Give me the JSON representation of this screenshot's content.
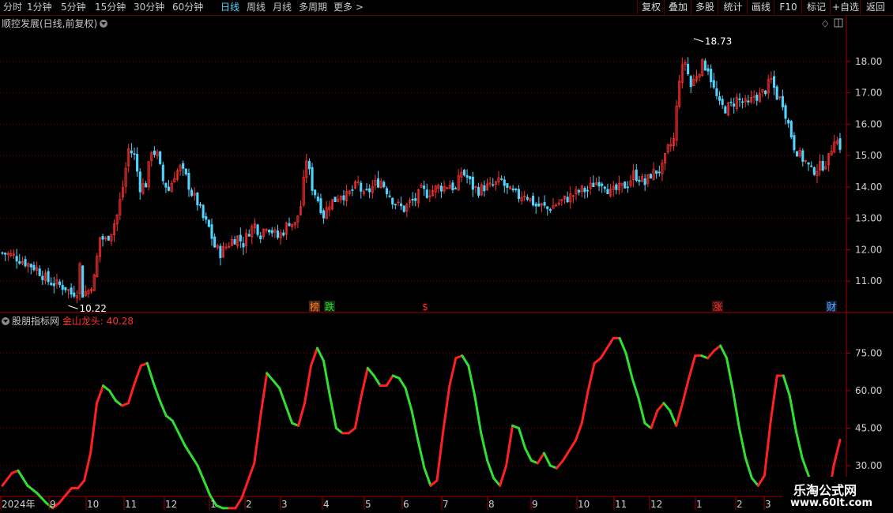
{
  "toolbar": {
    "periods": [
      "分时",
      "1分钟",
      "5分钟",
      "15分钟",
      "30分钟",
      "60分钟",
      "日线",
      "周线",
      "月线",
      "多周期",
      "更多 >"
    ],
    "active_period": "日线",
    "right_buttons": [
      "复权",
      "叠加",
      "多股",
      "统计",
      "画线",
      "F10",
      "标记",
      "+自选",
      "返回"
    ]
  },
  "main_chart": {
    "title": "顺控发展(日线,前复权)",
    "price_ticks": [
      "18.00",
      "17.00",
      "16.00",
      "15.00",
      "14.00",
      "13.00",
      "12.00",
      "11.00"
    ],
    "high_label": "18.73",
    "low_label": "10.22",
    "markers": [
      {
        "text": "榜",
        "color": "#ff7a2a",
        "bg": "#4a2a10"
      },
      {
        "text": "跌",
        "color": "#30e030",
        "bg": "#103010"
      },
      {
        "text": "$",
        "color": "#ff3030",
        "bg": "#000000"
      },
      {
        "text": "涨",
        "color": "#ff3030",
        "bg": "#3a1010"
      },
      {
        "text": "财",
        "color": "#5fb0ff",
        "bg": "#102040"
      }
    ]
  },
  "indicator": {
    "name": "股朋指标网",
    "series_label": "金山龙头: 40.28",
    "ticks": [
      "75.00",
      "60.00",
      "45.00",
      "30.00"
    ]
  },
  "x_axis": {
    "labels": [
      "2024年",
      "9",
      "10",
      "11",
      "12",
      "1",
      "2",
      "3",
      "4",
      "5",
      "6",
      "7",
      "8",
      "9",
      "10",
      "11",
      "12",
      "1",
      "2",
      "3"
    ]
  },
  "watermark": {
    "line1": "乐淘公式网",
    "line2": "www.60lt.com"
  },
  "colors": {
    "up": "#ff3030",
    "down": "#4fd6ff",
    "line_up": "#ff2020",
    "line_down": "#30e030",
    "grid": "#7a0000",
    "frame": "#a00000"
  },
  "chart_data": [
    {
      "type": "candlestick",
      "title": "顺控发展(日线,前复权)",
      "ylim": [
        10.0,
        19.0
      ],
      "high": 18.73,
      "low": 10.22,
      "close_path": [
        [
          0,
          11.9
        ],
        [
          4,
          11.8
        ],
        [
          8,
          11.6
        ],
        [
          12,
          11.4
        ],
        [
          16,
          11.0
        ],
        [
          19,
          10.9
        ],
        [
          22,
          10.8
        ],
        [
          24,
          10.6
        ],
        [
          26,
          10.7
        ],
        [
          27,
          11.5
        ],
        [
          28,
          10.6
        ],
        [
          30,
          10.7
        ],
        [
          32,
          11.1
        ],
        [
          34,
          12.4
        ],
        [
          36,
          12.3
        ],
        [
          38,
          12.6
        ],
        [
          40,
          13.1
        ],
        [
          42,
          14.0
        ],
        [
          44,
          15.2
        ],
        [
          46,
          15.0
        ],
        [
          48,
          14.0
        ],
        [
          50,
          14.1
        ],
        [
          52,
          15.2
        ],
        [
          54,
          15.0
        ],
        [
          56,
          14.2
        ],
        [
          58,
          13.9
        ],
        [
          60,
          14.4
        ],
        [
          62,
          14.6
        ],
        [
          64,
          14.3
        ],
        [
          66,
          13.8
        ],
        [
          68,
          13.5
        ],
        [
          70,
          13.0
        ],
        [
          72,
          12.7
        ],
        [
          74,
          12.1
        ],
        [
          76,
          11.9
        ],
        [
          78,
          12.1
        ],
        [
          80,
          12.3
        ],
        [
          82,
          12.4
        ],
        [
          84,
          12.2
        ],
        [
          86,
          12.6
        ],
        [
          88,
          12.8
        ],
        [
          90,
          12.5
        ],
        [
          92,
          12.8
        ],
        [
          94,
          12.6
        ],
        [
          96,
          12.4
        ],
        [
          98,
          12.6
        ],
        [
          100,
          12.9
        ],
        [
          102,
          12.8
        ],
        [
          104,
          13.4
        ],
        [
          106,
          14.9
        ],
        [
          108,
          14.0
        ],
        [
          110,
          13.6
        ],
        [
          112,
          13.1
        ],
        [
          114,
          13.5
        ],
        [
          116,
          13.6
        ],
        [
          118,
          13.8
        ],
        [
          120,
          13.7
        ],
        [
          122,
          13.9
        ],
        [
          124,
          14.1
        ],
        [
          126,
          13.7
        ],
        [
          128,
          13.9
        ],
        [
          130,
          14.1
        ],
        [
          132,
          14.2
        ],
        [
          134,
          13.9
        ],
        [
          136,
          13.6
        ],
        [
          138,
          13.4
        ],
        [
          140,
          13.3
        ],
        [
          142,
          13.5
        ],
        [
          144,
          13.6
        ],
        [
          146,
          13.9
        ],
        [
          148,
          13.8
        ],
        [
          150,
          13.9
        ],
        [
          152,
          14.0
        ],
        [
          154,
          14.0
        ],
        [
          156,
          14.1
        ],
        [
          158,
          13.9
        ],
        [
          160,
          14.5
        ],
        [
          162,
          14.3
        ],
        [
          164,
          14.0
        ],
        [
          166,
          13.9
        ],
        [
          168,
          14.0
        ],
        [
          170,
          14.0
        ],
        [
          172,
          14.1
        ],
        [
          174,
          14.2
        ],
        [
          176,
          13.9
        ],
        [
          178,
          13.8
        ],
        [
          180,
          13.7
        ],
        [
          182,
          13.8
        ],
        [
          184,
          13.6
        ],
        [
          186,
          13.4
        ],
        [
          188,
          13.4
        ],
        [
          190,
          13.3
        ],
        [
          192,
          13.4
        ],
        [
          194,
          13.5
        ],
        [
          196,
          13.6
        ],
        [
          198,
          13.7
        ],
        [
          200,
          13.8
        ],
        [
          202,
          13.9
        ],
        [
          204,
          13.9
        ],
        [
          206,
          14.1
        ],
        [
          208,
          14.2
        ],
        [
          210,
          14.1
        ],
        [
          212,
          13.8
        ],
        [
          214,
          13.9
        ],
        [
          216,
          14.0
        ],
        [
          218,
          14.1
        ],
        [
          220,
          14.4
        ],
        [
          222,
          14.3
        ],
        [
          224,
          14.1
        ],
        [
          226,
          14.4
        ],
        [
          228,
          14.5
        ],
        [
          230,
          14.6
        ],
        [
          232,
          15.2
        ],
        [
          234,
          15.5
        ],
        [
          236,
          17.5
        ],
        [
          238,
          18.0
        ],
        [
          240,
          17.2
        ],
        [
          242,
          17.6
        ],
        [
          244,
          17.9
        ],
        [
          246,
          17.8
        ],
        [
          248,
          17.1
        ],
        [
          250,
          16.6
        ],
        [
          252,
          16.5
        ],
        [
          254,
          16.6
        ],
        [
          256,
          16.8
        ],
        [
          258,
          16.7
        ],
        [
          260,
          16.6
        ],
        [
          262,
          16.9
        ],
        [
          264,
          16.9
        ],
        [
          266,
          17.1
        ],
        [
          268,
          17.4
        ],
        [
          270,
          16.9
        ],
        [
          272,
          16.7
        ],
        [
          274,
          16.0
        ],
        [
          276,
          15.3
        ],
        [
          278,
          15.0
        ],
        [
          280,
          14.8
        ],
        [
          282,
          14.5
        ],
        [
          284,
          14.6
        ],
        [
          286,
          14.7
        ],
        [
          288,
          14.9
        ],
        [
          290,
          15.6
        ],
        [
          292,
          15.3
        ]
      ]
    },
    {
      "type": "line",
      "series": [
        {
          "name": "金山龙头",
          "last": 40.28
        }
      ],
      "ylim": [
        18,
        90
      ],
      "points": [
        [
          0,
          22
        ],
        [
          3,
          27
        ],
        [
          5,
          28
        ],
        [
          8,
          22
        ],
        [
          11,
          19
        ],
        [
          14,
          15
        ],
        [
          16,
          13
        ],
        [
          18,
          15
        ],
        [
          20,
          18
        ],
        [
          22,
          21
        ],
        [
          24,
          21
        ],
        [
          26,
          24
        ],
        [
          28,
          35
        ],
        [
          30,
          55
        ],
        [
          32,
          62
        ],
        [
          34,
          60
        ],
        [
          36,
          56
        ],
        [
          38,
          54
        ],
        [
          40,
          55
        ],
        [
          42,
          63
        ],
        [
          44,
          70
        ],
        [
          46,
          71
        ],
        [
          48,
          63
        ],
        [
          50,
          56
        ],
        [
          52,
          50
        ],
        [
          54,
          48
        ],
        [
          56,
          43
        ],
        [
          58,
          38
        ],
        [
          60,
          34
        ],
        [
          62,
          30
        ],
        [
          64,
          24
        ],
        [
          66,
          18
        ],
        [
          68,
          14
        ],
        [
          70,
          12
        ],
        [
          72,
          11
        ],
        [
          74,
          12
        ],
        [
          76,
          17
        ],
        [
          78,
          24
        ],
        [
          80,
          31
        ],
        [
          82,
          50
        ],
        [
          84,
          67
        ],
        [
          86,
          64
        ],
        [
          88,
          61
        ],
        [
          90,
          54
        ],
        [
          92,
          47
        ],
        [
          94,
          46
        ],
        [
          96,
          55
        ],
        [
          98,
          70
        ],
        [
          100,
          77
        ],
        [
          102,
          72
        ],
        [
          104,
          58
        ],
        [
          106,
          45
        ],
        [
          108,
          43
        ],
        [
          110,
          43
        ],
        [
          112,
          45
        ],
        [
          114,
          58
        ],
        [
          116,
          69
        ],
        [
          118,
          66
        ],
        [
          120,
          62
        ],
        [
          122,
          62
        ],
        [
          124,
          66
        ],
        [
          126,
          65
        ],
        [
          128,
          61
        ],
        [
          130,
          52
        ],
        [
          132,
          40
        ],
        [
          134,
          29
        ],
        [
          136,
          22
        ],
        [
          138,
          24
        ],
        [
          140,
          44
        ],
        [
          142,
          62
        ],
        [
          144,
          73
        ],
        [
          146,
          74
        ],
        [
          148,
          70
        ],
        [
          150,
          58
        ],
        [
          152,
          43
        ],
        [
          154,
          32
        ],
        [
          156,
          25
        ],
        [
          158,
          22
        ],
        [
          160,
          30
        ],
        [
          162,
          46
        ],
        [
          164,
          45
        ],
        [
          166,
          37
        ],
        [
          168,
          32
        ],
        [
          170,
          31
        ],
        [
          172,
          35
        ],
        [
          174,
          30
        ],
        [
          176,
          29
        ],
        [
          178,
          32
        ],
        [
          180,
          36
        ],
        [
          182,
          40
        ],
        [
          184,
          47
        ],
        [
          186,
          60
        ],
        [
          188,
          71
        ],
        [
          190,
          73
        ],
        [
          192,
          77
        ],
        [
          194,
          81
        ],
        [
          196,
          81
        ],
        [
          198,
          75
        ],
        [
          200,
          65
        ],
        [
          202,
          57
        ],
        [
          204,
          47
        ],
        [
          206,
          45
        ],
        [
          208,
          52
        ],
        [
          210,
          55
        ],
        [
          212,
          52
        ],
        [
          214,
          46
        ],
        [
          216,
          55
        ],
        [
          218,
          65
        ],
        [
          220,
          74
        ],
        [
          222,
          74
        ],
        [
          224,
          73
        ],
        [
          226,
          76
        ],
        [
          228,
          78
        ],
        [
          230,
          73
        ],
        [
          232,
          60
        ],
        [
          234,
          45
        ],
        [
          236,
          33
        ],
        [
          238,
          25
        ],
        [
          240,
          22
        ],
        [
          242,
          26
        ],
        [
          244,
          48
        ],
        [
          246,
          66
        ],
        [
          248,
          66
        ],
        [
          250,
          58
        ],
        [
          252,
          44
        ],
        [
          254,
          33
        ],
        [
          256,
          26
        ],
        [
          258,
          18
        ],
        [
          260,
          14
        ],
        [
          262,
          15
        ],
        [
          264,
          30
        ],
        [
          266,
          40.28
        ]
      ]
    }
  ]
}
